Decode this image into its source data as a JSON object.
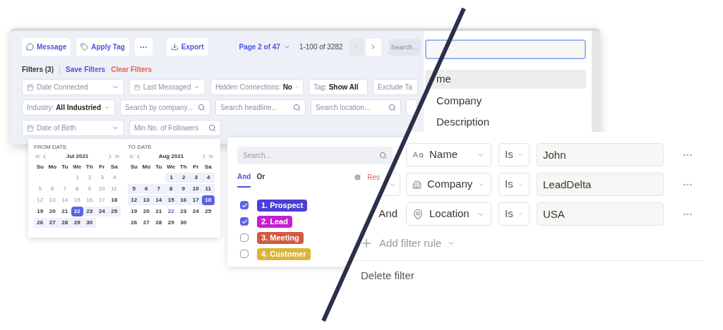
{
  "toolbar": {
    "buttons": [
      {
        "kind": "message",
        "label": "Message"
      },
      {
        "kind": "tag",
        "label": "Apply Tag"
      },
      {
        "kind": "more"
      },
      {
        "kind": "export",
        "label": "Export"
      }
    ],
    "page": "Page 2 of 47",
    "range": "1-100 of 3282",
    "prev": {
      "disabled": true
    },
    "next": {
      "disabled": false
    },
    "search": {
      "placeholder": "Search..."
    }
  },
  "filters_bar": {
    "count": "Filters (3)",
    "save": "Save Filters",
    "clear": "Clear Filters"
  },
  "filter_rows": [
    [
      {
        "kind": "date",
        "label": "Date Connected"
      },
      {
        "kind": "date",
        "label": "Last Messaged"
      },
      {
        "kind": "select",
        "label": "Hidden Connections: **No**"
      },
      {
        "kind": "select",
        "label": "Tag: **Show All**"
      },
      {
        "kind": "text",
        "label": "Exclude Ta"
      }
    ],
    [
      {
        "kind": "select",
        "label": "Industry: **All Industried**"
      },
      {
        "kind": "search",
        "label": "Search by company..."
      },
      {
        "kind": "search",
        "label": "Search headline..."
      },
      {
        "kind": "search",
        "label": "Search location..."
      },
      {
        "kind": "cut"
      }
    ],
    [
      {
        "kind": "date",
        "label": "Date of Birth"
      },
      {
        "kind": "search",
        "label": "Min No. of Followers"
      }
    ]
  ],
  "field_menu": {
    "search_focused": true,
    "items": [
      {
        "label": "me",
        "selected": true
      },
      {
        "label": "Company",
        "selected": false
      },
      {
        "label": "Description",
        "selected": false
      }
    ]
  },
  "date_picker": {
    "months": [
      {
        "heading": "FROM DATE",
        "month": "Jul 2021",
        "weekdays": [
          "Su",
          "Mo",
          "Tu",
          "We",
          "Th",
          "Fr",
          "Sa"
        ],
        "weeks": [
          [
            {
              "day": "1",
              "kind": "muted"
            },
            {
              "day": "2",
              "kind": "muted"
            },
            {
              "day": "3",
              "kind": "muted"
            },
            {
              "day": "4",
              "kind": "muted"
            }
          ],
          [
            {
              "day": "5",
              "kind": "muted"
            },
            {
              "day": "6",
              "kind": "muted"
            },
            {
              "day": "7",
              "kind": "muted"
            },
            {
              "day": "8",
              "kind": "muted"
            },
            {
              "day": "9",
              "kind": "muted"
            },
            {
              "day": "10",
              "kind": "muted"
            },
            {
              "day": "11",
              "kind": "muted"
            }
          ],
          [
            {
              "day": "12",
              "kind": "muted"
            },
            {
              "day": "13",
              "kind": "muted"
            },
            {
              "day": "14",
              "kind": "muted"
            },
            {
              "day": "15",
              "kind": "muted"
            },
            {
              "day": "16",
              "kind": "muted"
            },
            {
              "day": "17",
              "kind": "muted"
            },
            {
              "day": "18",
              "kind": "normal"
            }
          ],
          [
            {
              "day": "19",
              "kind": "normal"
            },
            {
              "day": "20",
              "kind": "normal"
            },
            {
              "day": "21",
              "kind": "normal"
            },
            {
              "day": "22",
              "kind": "selected"
            },
            {
              "day": "23",
              "kind": "range"
            },
            {
              "day": "24",
              "kind": "range"
            },
            {
              "day": "25",
              "kind": "range"
            }
          ],
          [
            {
              "day": "26",
              "kind": "range"
            },
            {
              "day": "27",
              "kind": "range"
            },
            {
              "day": "28",
              "kind": "range"
            },
            {
              "day": "29",
              "kind": "range"
            },
            {
              "day": "30",
              "kind": "range"
            }
          ]
        ]
      },
      {
        "heading": "TO DATE",
        "month": "Aug 2021",
        "weekdays": [
          "Su",
          "Mo",
          "Tu",
          "We",
          "Th",
          "Fr",
          "Sa"
        ],
        "weeks": [
          [
            {
              "day": "1",
              "kind": "range"
            },
            {
              "day": "2",
              "kind": "range"
            },
            {
              "day": "3",
              "kind": "range"
            },
            {
              "day": "4",
              "kind": "range"
            }
          ],
          [
            {
              "day": "5",
              "kind": "range"
            },
            {
              "day": "6",
              "kind": "range"
            },
            {
              "day": "7",
              "kind": "range"
            },
            {
              "day": "8",
              "kind": "range"
            },
            {
              "day": "9",
              "kind": "range"
            },
            {
              "day": "10",
              "kind": "range"
            },
            {
              "day": "11",
              "kind": "range"
            }
          ],
          [
            {
              "day": "12",
              "kind": "range"
            },
            {
              "day": "13",
              "kind": "range"
            },
            {
              "day": "14",
              "kind": "range"
            },
            {
              "day": "15",
              "kind": "range"
            },
            {
              "day": "16",
              "kind": "range"
            },
            {
              "day": "17",
              "kind": "range"
            },
            {
              "day": "18",
              "kind": "selected"
            }
          ],
          [
            {
              "day": "19",
              "kind": "normal"
            },
            {
              "day": "20",
              "kind": "normal"
            },
            {
              "day": "21",
              "kind": "normal"
            },
            {
              "day": "22",
              "kind": "today"
            },
            {
              "day": "23",
              "kind": "normal"
            },
            {
              "day": "24",
              "kind": "normal"
            },
            {
              "day": "25",
              "kind": "normal"
            }
          ],
          [
            {
              "day": "26",
              "kind": "normal"
            },
            {
              "day": "27",
              "kind": "normal"
            },
            {
              "day": "28",
              "kind": "normal"
            },
            {
              "day": "29",
              "kind": "normal"
            },
            {
              "day": "30",
              "kind": "normal"
            }
          ]
        ]
      }
    ]
  },
  "tag_filter": {
    "search": {
      "placeholder": "Search..."
    },
    "modes": [
      {
        "label": "And",
        "selected": true
      },
      {
        "label": "Or",
        "selected": false
      }
    ],
    "reset": "Res",
    "tags": [
      {
        "label": "1. Prospect",
        "color": "#4a3fd6",
        "checked": true
      },
      {
        "label": "2. Lead",
        "color": "#c51fd0",
        "checked": true
      },
      {
        "label": "3. Meeting",
        "color": "#d05a40",
        "checked": false
      },
      {
        "label": "4. Customer",
        "color": "#ddb43a",
        "checked": false
      }
    ]
  },
  "rule_panel": {
    "rules": [
      {
        "field": {
          "label": "Name",
          "kind": "text"
        },
        "op": "Is",
        "value": "John"
      },
      {
        "connector": {
          "kind": "select"
        },
        "field": {
          "label": "Company",
          "kind": "company"
        },
        "op": "Is",
        "value": "LeadDelta"
      },
      {
        "connector": {
          "kind": "text",
          "label": "And"
        },
        "field": {
          "label": "Location",
          "kind": "location"
        },
        "op": "Is",
        "value": "USA"
      }
    ],
    "add_rule": "Add filter rule",
    "delete": "Delete filter"
  }
}
